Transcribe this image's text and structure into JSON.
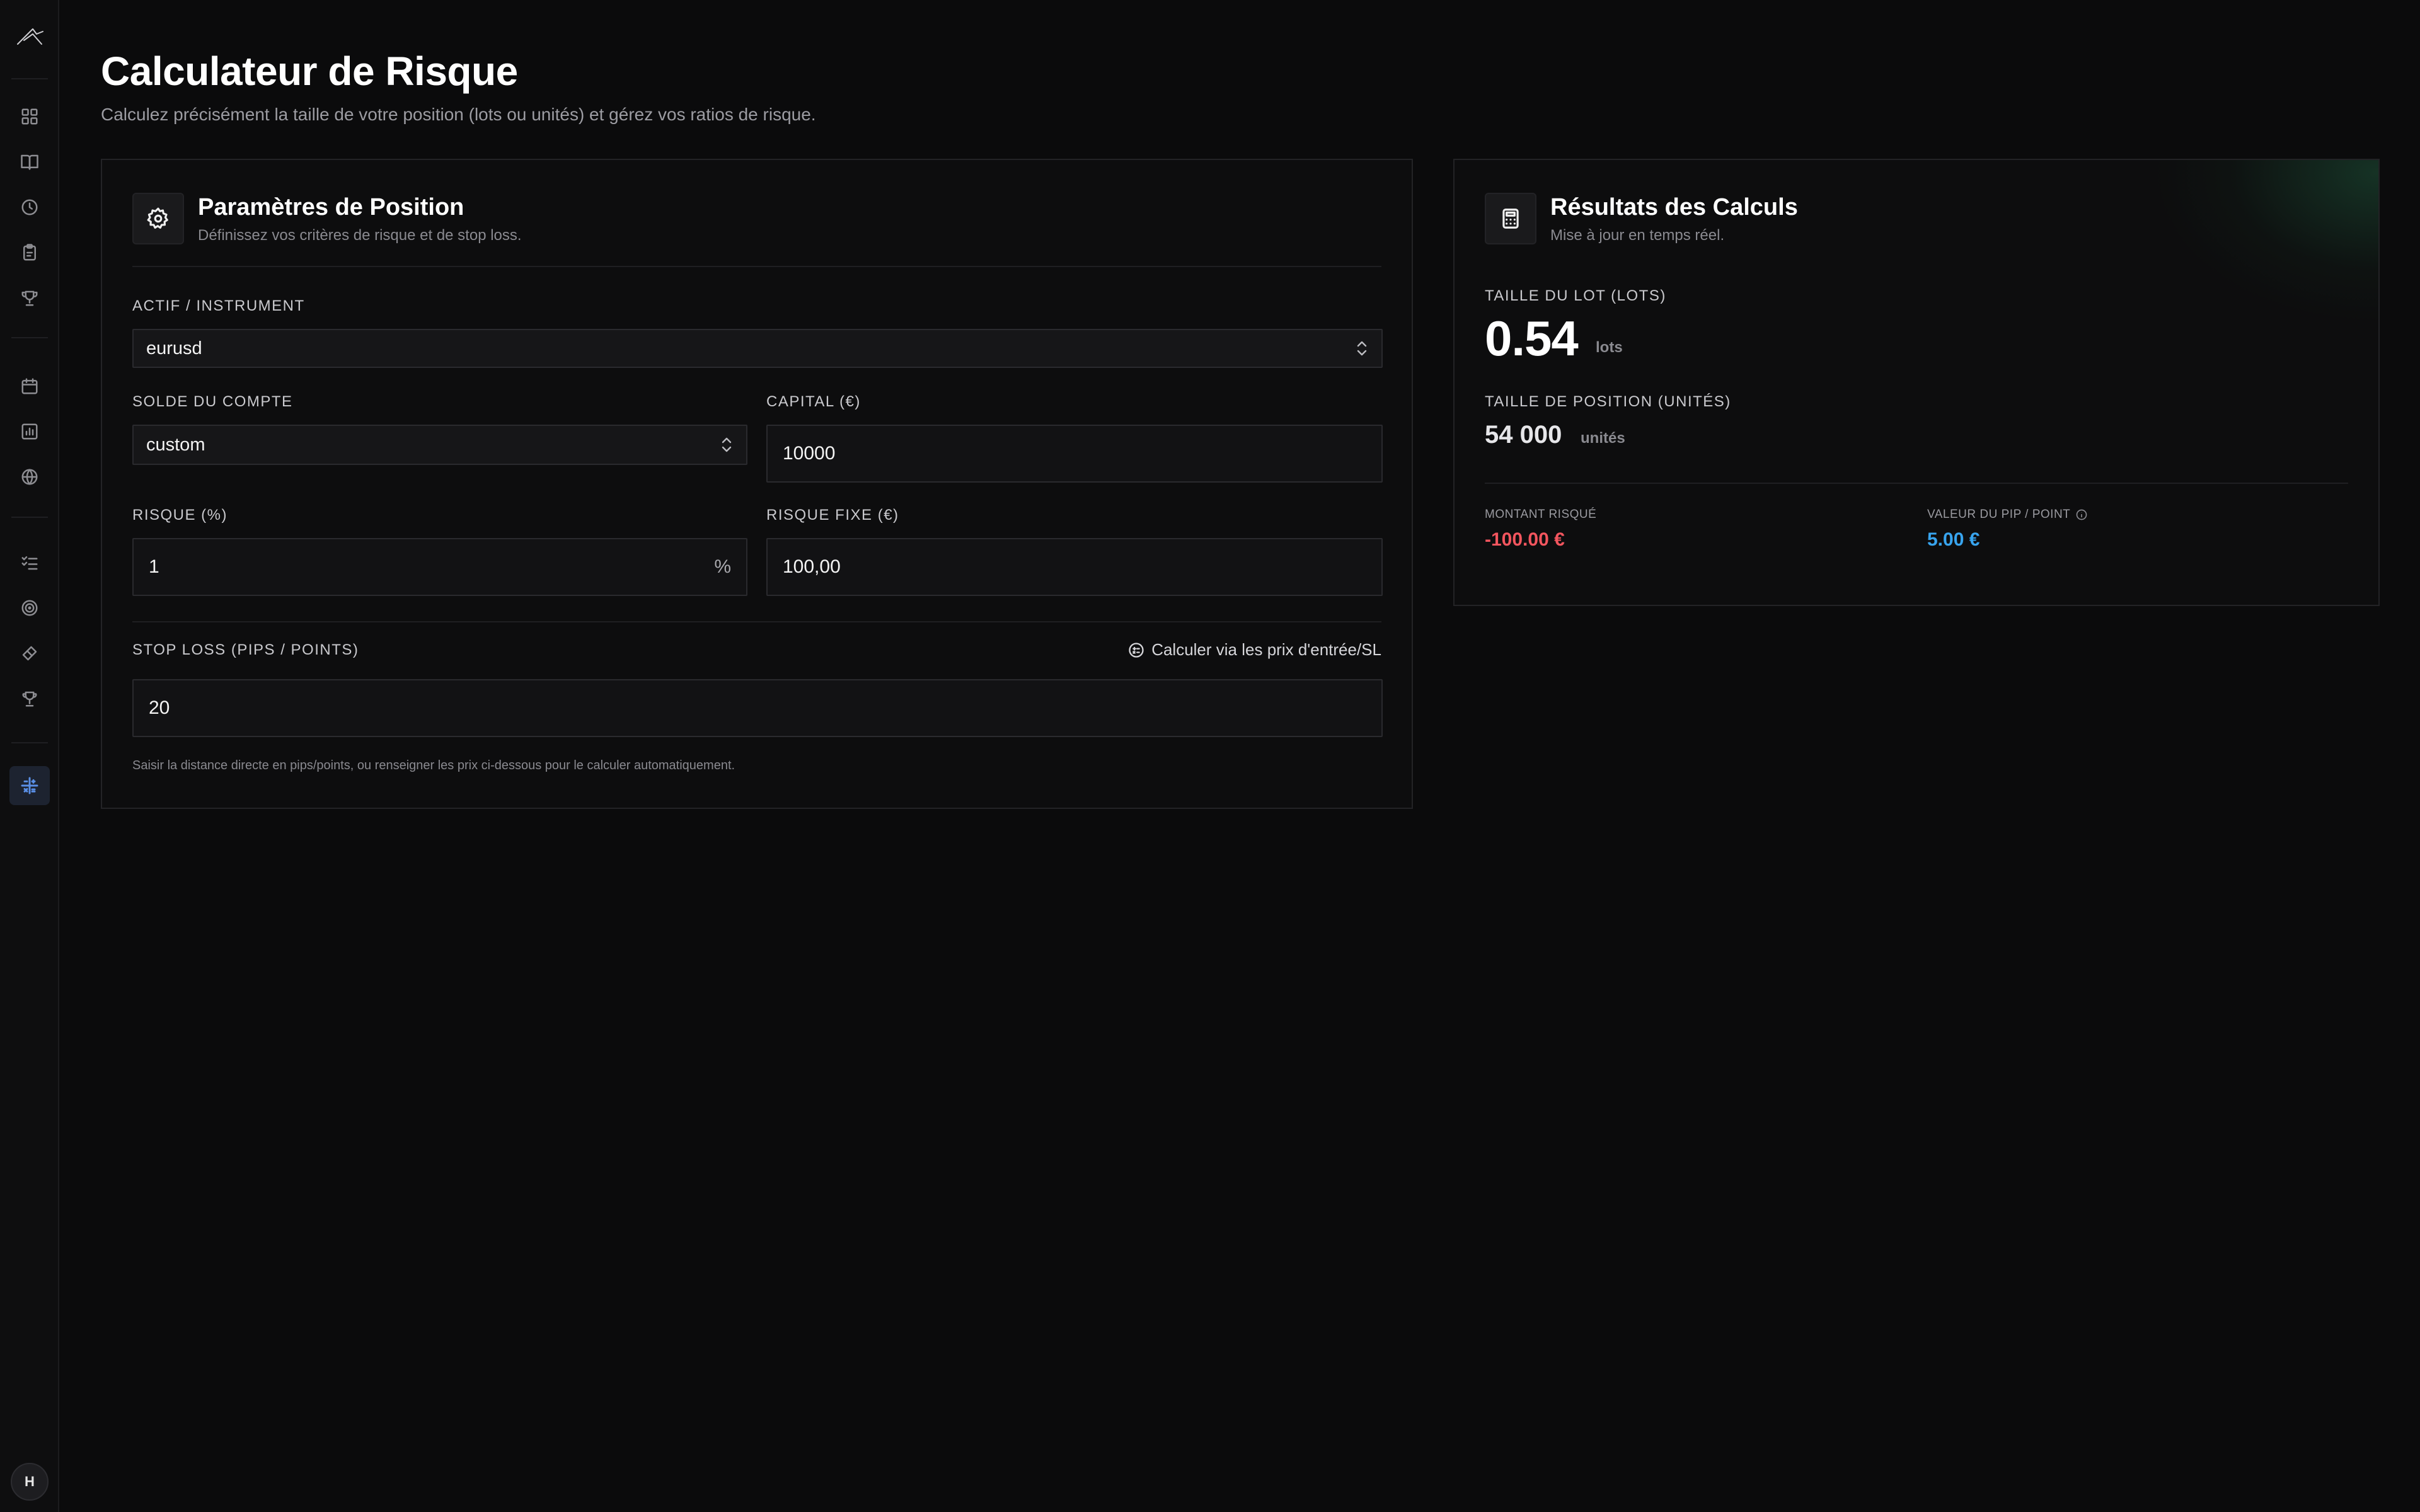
{
  "header": {
    "title": "Calculateur de Risque",
    "subtitle": "Calculez précisément la taille de votre position (lots ou unités) et gérez vos ratios de risque."
  },
  "sidebar": {
    "icons": [
      "logo-icon",
      "dashboard-icon",
      "journal-icon",
      "clock-icon",
      "clipboard-icon",
      "trophy-icon",
      "calendar-icon",
      "chart-icon",
      "globe-icon",
      "checklist-icon",
      "target-icon",
      "ticket-icon",
      "award-icon",
      "calculator-icon"
    ],
    "avatar_initial": "H",
    "active_color": "#5a8fe6"
  },
  "params": {
    "title": "Paramètres de Position",
    "description": "Définissez vos critères de risque et de stop loss.",
    "instrument_label": "ACTIF / INSTRUMENT",
    "instrument_value": "eurusd",
    "balance_label": "SOLDE DU COMPTE",
    "balance_value": "custom",
    "capital_label": "CAPITAL (€)",
    "capital_value": "10000",
    "risk_pct_label": "RISQUE (%)",
    "risk_pct_value": "1",
    "risk_pct_suffix": "%",
    "risk_fixed_label": "RISQUE FIXE (€)",
    "risk_fixed_value": "100,00",
    "stoploss_label": "STOP LOSS (PIPS / POINTS)",
    "calc_link": "Calculer via les prix d'entrée/SL",
    "stoploss_value": "20",
    "hint": "Saisir la distance directe en pips/points, ou renseigner les prix ci-dessous pour le calculer automatiquement."
  },
  "results": {
    "title": "Résultats des Calculs",
    "description": "Mise à jour en temps réel.",
    "lot_label": "TAILLE DU LOT (LOTS)",
    "lot_value": "0.54",
    "lot_unit": "lots",
    "position_label": "TAILLE DE POSITION (UNITÉS)",
    "position_value": "54 000",
    "position_unit": "unités",
    "risk_amount_label": "MONTANT RISQUÉ",
    "risk_amount_value": "-100.00 €",
    "pip_value_label": "VALEUR DU PIP / POINT",
    "pip_value_value": "5.00 €",
    "risk_color": "#f2555e",
    "pip_color": "#38a4ee"
  }
}
